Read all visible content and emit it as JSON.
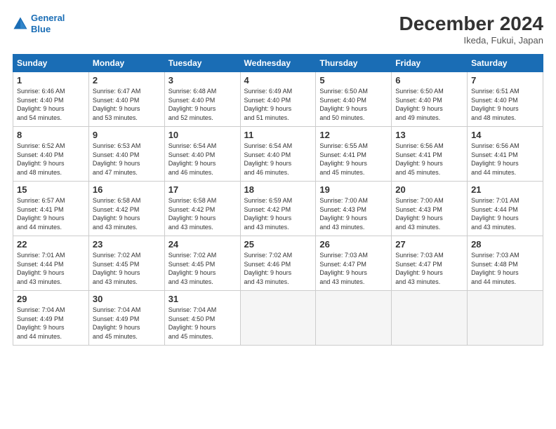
{
  "header": {
    "logo_line1": "General",
    "logo_line2": "Blue",
    "month_title": "December 2024",
    "location": "Ikeda, Fukui, Japan"
  },
  "days_of_week": [
    "Sunday",
    "Monday",
    "Tuesday",
    "Wednesday",
    "Thursday",
    "Friday",
    "Saturday"
  ],
  "weeks": [
    [
      {
        "day": "1",
        "info": "Sunrise: 6:46 AM\nSunset: 4:40 PM\nDaylight: 9 hours\nand 54 minutes."
      },
      {
        "day": "2",
        "info": "Sunrise: 6:47 AM\nSunset: 4:40 PM\nDaylight: 9 hours\nand 53 minutes."
      },
      {
        "day": "3",
        "info": "Sunrise: 6:48 AM\nSunset: 4:40 PM\nDaylight: 9 hours\nand 52 minutes."
      },
      {
        "day": "4",
        "info": "Sunrise: 6:49 AM\nSunset: 4:40 PM\nDaylight: 9 hours\nand 51 minutes."
      },
      {
        "day": "5",
        "info": "Sunrise: 6:50 AM\nSunset: 4:40 PM\nDaylight: 9 hours\nand 50 minutes."
      },
      {
        "day": "6",
        "info": "Sunrise: 6:50 AM\nSunset: 4:40 PM\nDaylight: 9 hours\nand 49 minutes."
      },
      {
        "day": "7",
        "info": "Sunrise: 6:51 AM\nSunset: 4:40 PM\nDaylight: 9 hours\nand 48 minutes."
      }
    ],
    [
      {
        "day": "8",
        "info": "Sunrise: 6:52 AM\nSunset: 4:40 PM\nDaylight: 9 hours\nand 48 minutes."
      },
      {
        "day": "9",
        "info": "Sunrise: 6:53 AM\nSunset: 4:40 PM\nDaylight: 9 hours\nand 47 minutes."
      },
      {
        "day": "10",
        "info": "Sunrise: 6:54 AM\nSunset: 4:40 PM\nDaylight: 9 hours\nand 46 minutes."
      },
      {
        "day": "11",
        "info": "Sunrise: 6:54 AM\nSunset: 4:40 PM\nDaylight: 9 hours\nand 46 minutes."
      },
      {
        "day": "12",
        "info": "Sunrise: 6:55 AM\nSunset: 4:41 PM\nDaylight: 9 hours\nand 45 minutes."
      },
      {
        "day": "13",
        "info": "Sunrise: 6:56 AM\nSunset: 4:41 PM\nDaylight: 9 hours\nand 45 minutes."
      },
      {
        "day": "14",
        "info": "Sunrise: 6:56 AM\nSunset: 4:41 PM\nDaylight: 9 hours\nand 44 minutes."
      }
    ],
    [
      {
        "day": "15",
        "info": "Sunrise: 6:57 AM\nSunset: 4:41 PM\nDaylight: 9 hours\nand 44 minutes."
      },
      {
        "day": "16",
        "info": "Sunrise: 6:58 AM\nSunset: 4:42 PM\nDaylight: 9 hours\nand 43 minutes."
      },
      {
        "day": "17",
        "info": "Sunrise: 6:58 AM\nSunset: 4:42 PM\nDaylight: 9 hours\nand 43 minutes."
      },
      {
        "day": "18",
        "info": "Sunrise: 6:59 AM\nSunset: 4:42 PM\nDaylight: 9 hours\nand 43 minutes."
      },
      {
        "day": "19",
        "info": "Sunrise: 7:00 AM\nSunset: 4:43 PM\nDaylight: 9 hours\nand 43 minutes."
      },
      {
        "day": "20",
        "info": "Sunrise: 7:00 AM\nSunset: 4:43 PM\nDaylight: 9 hours\nand 43 minutes."
      },
      {
        "day": "21",
        "info": "Sunrise: 7:01 AM\nSunset: 4:44 PM\nDaylight: 9 hours\nand 43 minutes."
      }
    ],
    [
      {
        "day": "22",
        "info": "Sunrise: 7:01 AM\nSunset: 4:44 PM\nDaylight: 9 hours\nand 43 minutes."
      },
      {
        "day": "23",
        "info": "Sunrise: 7:02 AM\nSunset: 4:45 PM\nDaylight: 9 hours\nand 43 minutes."
      },
      {
        "day": "24",
        "info": "Sunrise: 7:02 AM\nSunset: 4:45 PM\nDaylight: 9 hours\nand 43 minutes."
      },
      {
        "day": "25",
        "info": "Sunrise: 7:02 AM\nSunset: 4:46 PM\nDaylight: 9 hours\nand 43 minutes."
      },
      {
        "day": "26",
        "info": "Sunrise: 7:03 AM\nSunset: 4:47 PM\nDaylight: 9 hours\nand 43 minutes."
      },
      {
        "day": "27",
        "info": "Sunrise: 7:03 AM\nSunset: 4:47 PM\nDaylight: 9 hours\nand 43 minutes."
      },
      {
        "day": "28",
        "info": "Sunrise: 7:03 AM\nSunset: 4:48 PM\nDaylight: 9 hours\nand 44 minutes."
      }
    ],
    [
      {
        "day": "29",
        "info": "Sunrise: 7:04 AM\nSunset: 4:49 PM\nDaylight: 9 hours\nand 44 minutes."
      },
      {
        "day": "30",
        "info": "Sunrise: 7:04 AM\nSunset: 4:49 PM\nDaylight: 9 hours\nand 45 minutes."
      },
      {
        "day": "31",
        "info": "Sunrise: 7:04 AM\nSunset: 4:50 PM\nDaylight: 9 hours\nand 45 minutes."
      },
      null,
      null,
      null,
      null
    ]
  ]
}
